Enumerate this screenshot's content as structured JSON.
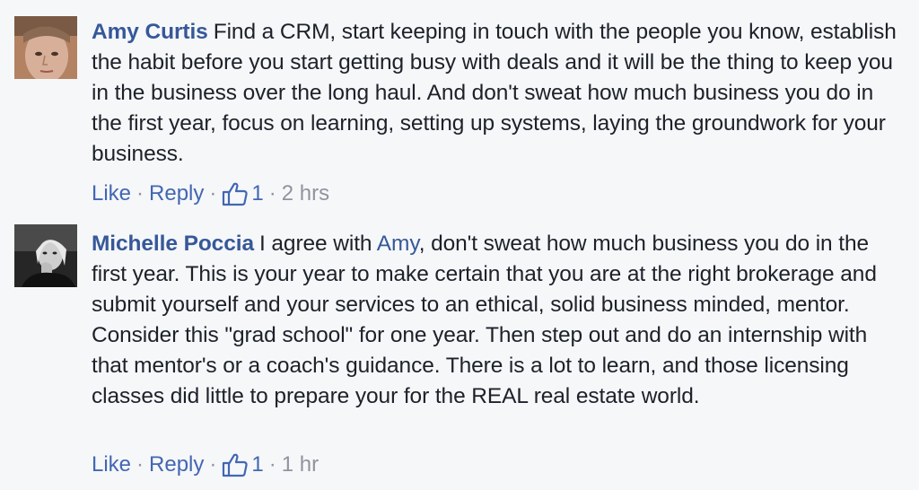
{
  "comments": [
    {
      "author": "Amy Curtis",
      "text": "Find a CRM, start keeping in touch with the people you know, establish the habit before you start getting busy with deals and it will be the thing to keep you in the business over the long haul. And don't sweat how much business you do in the first year, focus on learning, setting up systems, laying the groundwork for your business.",
      "like_label": "Like",
      "reply_label": "Reply",
      "likes": "1",
      "time": "2 hrs"
    },
    {
      "author": "Michelle Poccia",
      "text_before": "I agree with ",
      "mention": "Amy",
      "text_after": ", don't sweat how much business you do in the first year. This is your year to make certain that you are at the right brokerage and submit yourself and your services to an ethical, solid business minded, mentor. Consider this \"grad school\" for one year. Then step out and do an internship with that mentor's or a coach's guidance. There is a lot to learn, and those licensing classes did little to prepare your for the REAL real estate world.",
      "like_label": "Like",
      "reply_label": "Reply",
      "likes": "1",
      "time": "1 hr"
    }
  ],
  "separator": "·",
  "colors": {
    "link": "#365899",
    "action_link": "#4267b2",
    "meta": "#90949c",
    "text": "#1d2129",
    "background": "#f6f7f9"
  },
  "icons": {
    "like": "thumbs-up-icon"
  }
}
